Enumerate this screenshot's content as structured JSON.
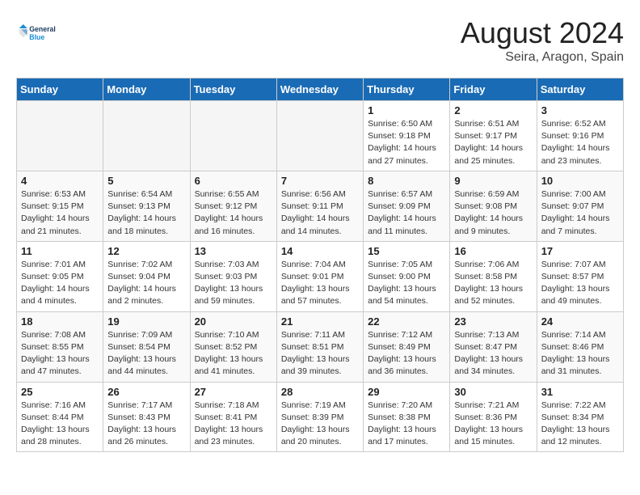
{
  "logo": {
    "line1": "General",
    "line2": "Blue"
  },
  "title": "August 2024",
  "subtitle": "Seira, Aragon, Spain",
  "days_of_week": [
    "Sunday",
    "Monday",
    "Tuesday",
    "Wednesday",
    "Thursday",
    "Friday",
    "Saturday"
  ],
  "weeks": [
    [
      {
        "day": "",
        "info": ""
      },
      {
        "day": "",
        "info": ""
      },
      {
        "day": "",
        "info": ""
      },
      {
        "day": "",
        "info": ""
      },
      {
        "day": "1",
        "info": "Sunrise: 6:50 AM\nSunset: 9:18 PM\nDaylight: 14 hours\nand 27 minutes."
      },
      {
        "day": "2",
        "info": "Sunrise: 6:51 AM\nSunset: 9:17 PM\nDaylight: 14 hours\nand 25 minutes."
      },
      {
        "day": "3",
        "info": "Sunrise: 6:52 AM\nSunset: 9:16 PM\nDaylight: 14 hours\nand 23 minutes."
      }
    ],
    [
      {
        "day": "4",
        "info": "Sunrise: 6:53 AM\nSunset: 9:15 PM\nDaylight: 14 hours\nand 21 minutes."
      },
      {
        "day": "5",
        "info": "Sunrise: 6:54 AM\nSunset: 9:13 PM\nDaylight: 14 hours\nand 18 minutes."
      },
      {
        "day": "6",
        "info": "Sunrise: 6:55 AM\nSunset: 9:12 PM\nDaylight: 14 hours\nand 16 minutes."
      },
      {
        "day": "7",
        "info": "Sunrise: 6:56 AM\nSunset: 9:11 PM\nDaylight: 14 hours\nand 14 minutes."
      },
      {
        "day": "8",
        "info": "Sunrise: 6:57 AM\nSunset: 9:09 PM\nDaylight: 14 hours\nand 11 minutes."
      },
      {
        "day": "9",
        "info": "Sunrise: 6:59 AM\nSunset: 9:08 PM\nDaylight: 14 hours\nand 9 minutes."
      },
      {
        "day": "10",
        "info": "Sunrise: 7:00 AM\nSunset: 9:07 PM\nDaylight: 14 hours\nand 7 minutes."
      }
    ],
    [
      {
        "day": "11",
        "info": "Sunrise: 7:01 AM\nSunset: 9:05 PM\nDaylight: 14 hours\nand 4 minutes."
      },
      {
        "day": "12",
        "info": "Sunrise: 7:02 AM\nSunset: 9:04 PM\nDaylight: 14 hours\nand 2 minutes."
      },
      {
        "day": "13",
        "info": "Sunrise: 7:03 AM\nSunset: 9:03 PM\nDaylight: 13 hours\nand 59 minutes."
      },
      {
        "day": "14",
        "info": "Sunrise: 7:04 AM\nSunset: 9:01 PM\nDaylight: 13 hours\nand 57 minutes."
      },
      {
        "day": "15",
        "info": "Sunrise: 7:05 AM\nSunset: 9:00 PM\nDaylight: 13 hours\nand 54 minutes."
      },
      {
        "day": "16",
        "info": "Sunrise: 7:06 AM\nSunset: 8:58 PM\nDaylight: 13 hours\nand 52 minutes."
      },
      {
        "day": "17",
        "info": "Sunrise: 7:07 AM\nSunset: 8:57 PM\nDaylight: 13 hours\nand 49 minutes."
      }
    ],
    [
      {
        "day": "18",
        "info": "Sunrise: 7:08 AM\nSunset: 8:55 PM\nDaylight: 13 hours\nand 47 minutes."
      },
      {
        "day": "19",
        "info": "Sunrise: 7:09 AM\nSunset: 8:54 PM\nDaylight: 13 hours\nand 44 minutes."
      },
      {
        "day": "20",
        "info": "Sunrise: 7:10 AM\nSunset: 8:52 PM\nDaylight: 13 hours\nand 41 minutes."
      },
      {
        "day": "21",
        "info": "Sunrise: 7:11 AM\nSunset: 8:51 PM\nDaylight: 13 hours\nand 39 minutes."
      },
      {
        "day": "22",
        "info": "Sunrise: 7:12 AM\nSunset: 8:49 PM\nDaylight: 13 hours\nand 36 minutes."
      },
      {
        "day": "23",
        "info": "Sunrise: 7:13 AM\nSunset: 8:47 PM\nDaylight: 13 hours\nand 34 minutes."
      },
      {
        "day": "24",
        "info": "Sunrise: 7:14 AM\nSunset: 8:46 PM\nDaylight: 13 hours\nand 31 minutes."
      }
    ],
    [
      {
        "day": "25",
        "info": "Sunrise: 7:16 AM\nSunset: 8:44 PM\nDaylight: 13 hours\nand 28 minutes."
      },
      {
        "day": "26",
        "info": "Sunrise: 7:17 AM\nSunset: 8:43 PM\nDaylight: 13 hours\nand 26 minutes."
      },
      {
        "day": "27",
        "info": "Sunrise: 7:18 AM\nSunset: 8:41 PM\nDaylight: 13 hours\nand 23 minutes."
      },
      {
        "day": "28",
        "info": "Sunrise: 7:19 AM\nSunset: 8:39 PM\nDaylight: 13 hours\nand 20 minutes."
      },
      {
        "day": "29",
        "info": "Sunrise: 7:20 AM\nSunset: 8:38 PM\nDaylight: 13 hours\nand 17 minutes."
      },
      {
        "day": "30",
        "info": "Sunrise: 7:21 AM\nSunset: 8:36 PM\nDaylight: 13 hours\nand 15 minutes."
      },
      {
        "day": "31",
        "info": "Sunrise: 7:22 AM\nSunset: 8:34 PM\nDaylight: 13 hours\nand 12 minutes."
      }
    ]
  ]
}
